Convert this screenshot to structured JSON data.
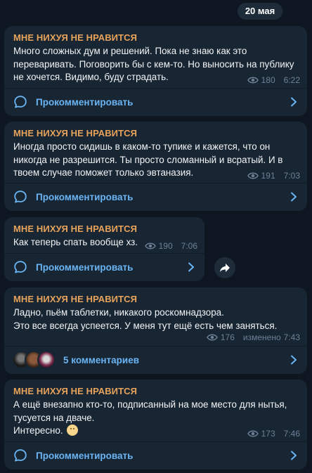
{
  "date_separator": "20 мая",
  "posts": [
    {
      "author": "МНЕ НИХУЯ НЕ НРАВИТСЯ",
      "text": "Много сложных дум и решений. Пока не знаю как это\nпереваривать. Поговорить бы с кем-то. Но выносить на публику\nне хочется. Видимо, буду страдать.",
      "views": "180",
      "time": "6:22",
      "comment_label": "Прокомментировать"
    },
    {
      "author": "МНЕ НИХУЯ НЕ НРАВИТСЯ",
      "text": "Иногда просто сидишь в каком-то тупике и кажется, что он\nникогда не разрешится. Ты просто сломанный и всратый. И в\nтвоем случае поможет только эвтаназия.",
      "views": "191",
      "time": "7:03",
      "comment_label": "Прокомментировать"
    },
    {
      "author": "МНЕ НИХУЯ НЕ НРАВИТСЯ",
      "text": "Как теперь спать вообще хз.",
      "views": "190",
      "time": "7:06",
      "comment_label": "Прокомментировать"
    },
    {
      "author": "МНЕ НИХУЯ НЕ НРАВИТСЯ",
      "text": "Ладно, пьём таблетки, никакого роскомнадзора.\nЭто все всегда успеется. У меня тут ещё есть чем заняться.",
      "views": "176",
      "edited": "изменено",
      "time": "7:43",
      "comment_label": "5 комментариев"
    },
    {
      "author": "МНЕ НИХУЯ НЕ НРАВИТСЯ",
      "text": "А ещё внезапно кто-то, подписанный на мое место для нытья,\nтусуется на дваче.\nИнтересно.",
      "views": "173",
      "time": "7:46",
      "comment_label": "Прокомментировать"
    }
  ],
  "icons": {
    "views": "eye-icon",
    "comment": "comment-bubble-icon",
    "chevron": "chevron-right-icon",
    "share": "share-arrow-icon",
    "emoji": "smiling-face-emoji"
  },
  "colors": {
    "background": "#0e1621",
    "bubble": "#182533",
    "author": "#e8a35b",
    "link": "#6ab4f3",
    "meta": "#6d8196"
  }
}
